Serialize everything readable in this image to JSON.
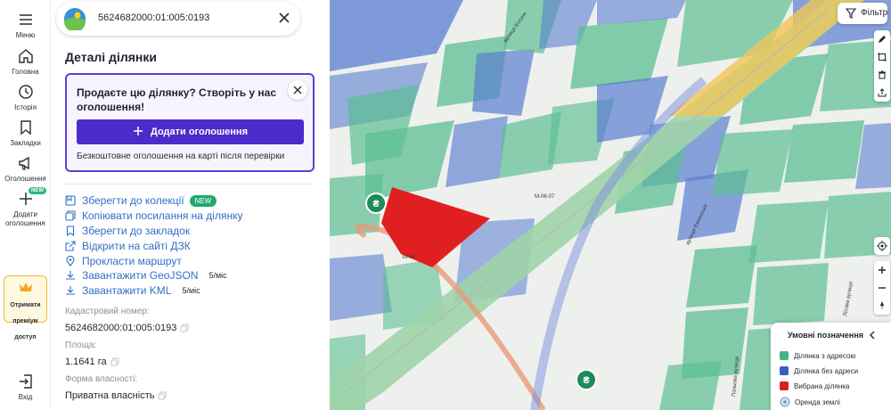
{
  "rail": {
    "menu": "Меню",
    "home": "Головна",
    "history": "Історія",
    "bookmarks": "Закладки",
    "ads": "Оголошення",
    "add_ad": "Додати оголошення",
    "add_ad_badge": "NEW",
    "premium": "Отримати преміум доступ",
    "logout": "Вхід"
  },
  "search": {
    "value": "5624682000:01:005:0193"
  },
  "panel": {
    "title": "Деталі ділянки",
    "promo": {
      "title": "Продаєте цю ділянку? Створіть у нас оголошення!",
      "button": "Додати оголошення",
      "note": "Безкоштовне оголошення на карті після перевірки"
    },
    "actions": [
      {
        "label": "Зберегти до колекції",
        "tag": "NEW",
        "quota": ""
      },
      {
        "label": "Копіювати посилання на ділянку",
        "tag": "",
        "quota": ""
      },
      {
        "label": "Зберегти до закладок",
        "tag": "",
        "quota": ""
      },
      {
        "label": "Відкрити на сайті ДЗК",
        "tag": "",
        "quota": ""
      },
      {
        "label": "Прокласти маршрут",
        "tag": "",
        "quota": ""
      },
      {
        "label": "Завантажити GeoJSON",
        "tag": "",
        "quota": "5/міс"
      },
      {
        "label": "Завантажити KML",
        "tag": "",
        "quota": "5/міс"
      }
    ],
    "fields": [
      {
        "label": "Кадастровий номер:",
        "value": "5624682000:01:005:0193"
      },
      {
        "label": "Площа:",
        "value": "1.1641 га"
      },
      {
        "label": "Форма власності:",
        "value": "Приватна власність"
      }
    ]
  },
  "map": {
    "filter": "Фільтр",
    "road_labels": {
      "m06a": "М-06-07",
      "m06b": "М-06",
      "st1": "вулиця Богуна",
      "st2": "вулиця Євгенська",
      "st3": "Лісова вулиця",
      "st4": "Польова вулиця"
    },
    "legend": {
      "title": "Умовні позначення",
      "items": [
        {
          "label": "Ділянка з адресою",
          "color": "#3cb88a"
        },
        {
          "label": "Ділянка без адреси",
          "color": "#3a5fc4"
        },
        {
          "label": "Вибрана ділянка",
          "color": "#d8221f"
        },
        {
          "label": "Оренда землі",
          "color": "#9bb3c9"
        }
      ]
    }
  },
  "colors": {
    "accent": "#4b2bc9",
    "link": "#2f6fc4",
    "parcel_address": "#5cbf93",
    "parcel_no_address": "#5a7ed0",
    "selected": "#e02020"
  }
}
